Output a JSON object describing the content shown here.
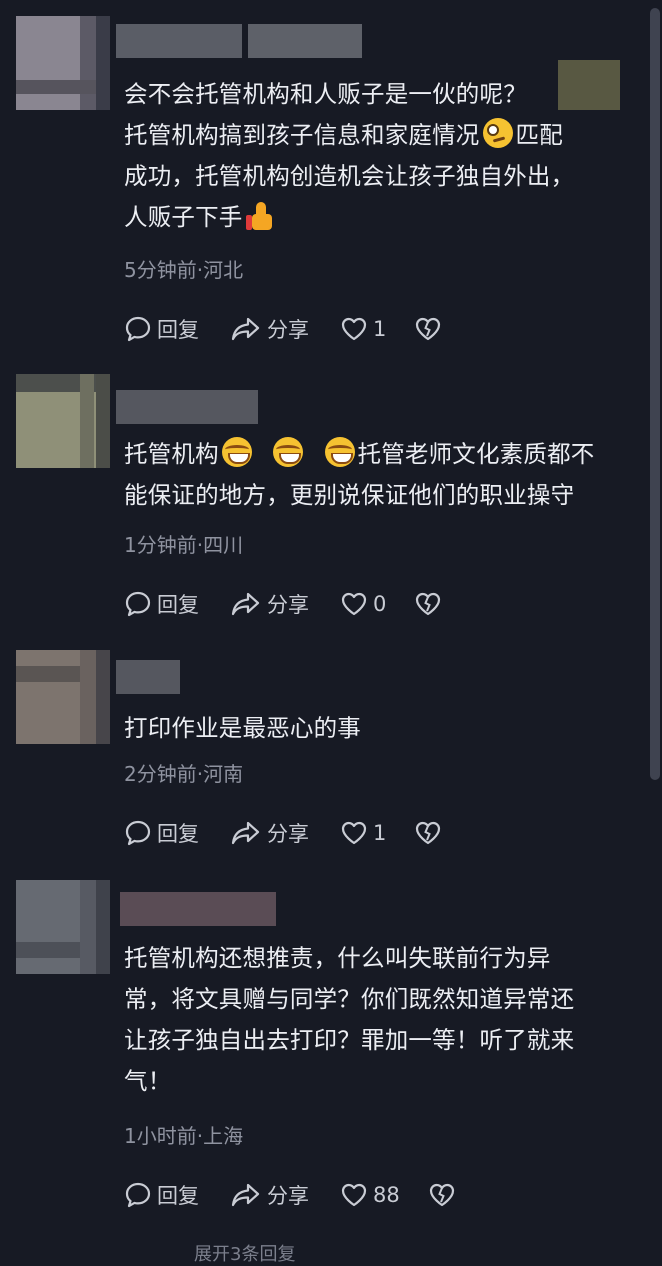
{
  "comments": [
    {
      "lines": [
        "会不会托管机构和人贩子是一伙的呢？",
        "托管机构搞到孩子信息和家庭情况",
        "匹配",
        "成功，托管机构创造机会让孩子独自外出，",
        "人贩子下手"
      ],
      "emojis": [
        "smirk",
        "thumbs-up"
      ],
      "time": "5分钟前",
      "location": "河北",
      "likes": "1",
      "reply_label": "回复",
      "share_label": "分享"
    },
    {
      "lines": [
        "托管机构",
        "托管老师文化素质都不",
        "能保证的地方，更别说保证他们的职业操守"
      ],
      "emojis": [
        "grin-sweat",
        "grin-sweat",
        "grin-sweat"
      ],
      "time": "1分钟前",
      "location": "四川",
      "likes": "0",
      "reply_label": "回复",
      "share_label": "分享"
    },
    {
      "lines": [
        "打印作业是最恶心的事"
      ],
      "time": "2分钟前",
      "location": "河南",
      "likes": "1",
      "reply_label": "回复",
      "share_label": "分享"
    },
    {
      "lines": [
        "托管机构还想推责，什么叫失联前行为异",
        "常，将文具赠与同学？你们既然知道异常还",
        "让孩子独自出去打印？罪加一等！听了就来",
        "气！"
      ],
      "time": "1小时前",
      "location": "上海",
      "likes": "88",
      "reply_label": "回复",
      "share_label": "分享"
    }
  ],
  "meta_separator": "·",
  "more_replies": "展开3条回复",
  "colors": {
    "background": "#171a24",
    "text": "#eceef3",
    "meta": "#8f93a0",
    "action": "#c9ccd4"
  }
}
